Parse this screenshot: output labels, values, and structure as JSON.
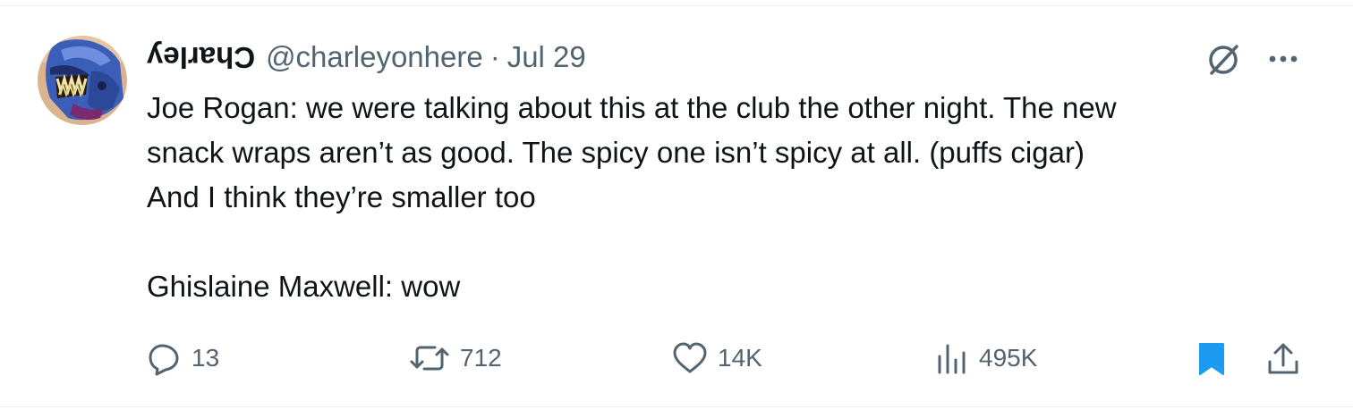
{
  "tweet": {
    "display_name": "Charley",
    "handle": "@charleyonhere",
    "separator": "·",
    "date": "Jul 29",
    "text_paragraphs": [
      "Joe Rogan: we were talking about this at the club the other night. The new\nsnack wraps aren’t as good. The spicy one isn’t spicy at all. (puffs cigar)\nAnd I think they’re smaller too",
      "Ghislaine Maxwell: wow"
    ],
    "header_icons": [
      "grok-icon",
      "more-icon"
    ]
  },
  "actions": {
    "reply": {
      "icon": "reply-icon",
      "count": "13"
    },
    "retweet": {
      "icon": "retweet-icon",
      "count": "712"
    },
    "like": {
      "icon": "heart-icon",
      "count": "14K"
    },
    "views": {
      "icon": "views-icon",
      "count": "495K"
    },
    "bookmark": {
      "icon": "bookmark-icon",
      "state": "bookmarked"
    },
    "share": {
      "icon": "share-icon"
    }
  },
  "colors": {
    "text_primary": "#0f1419",
    "text_secondary": "#536471",
    "accent_blue": "#1d9bf0",
    "border": "#eff3f4"
  }
}
